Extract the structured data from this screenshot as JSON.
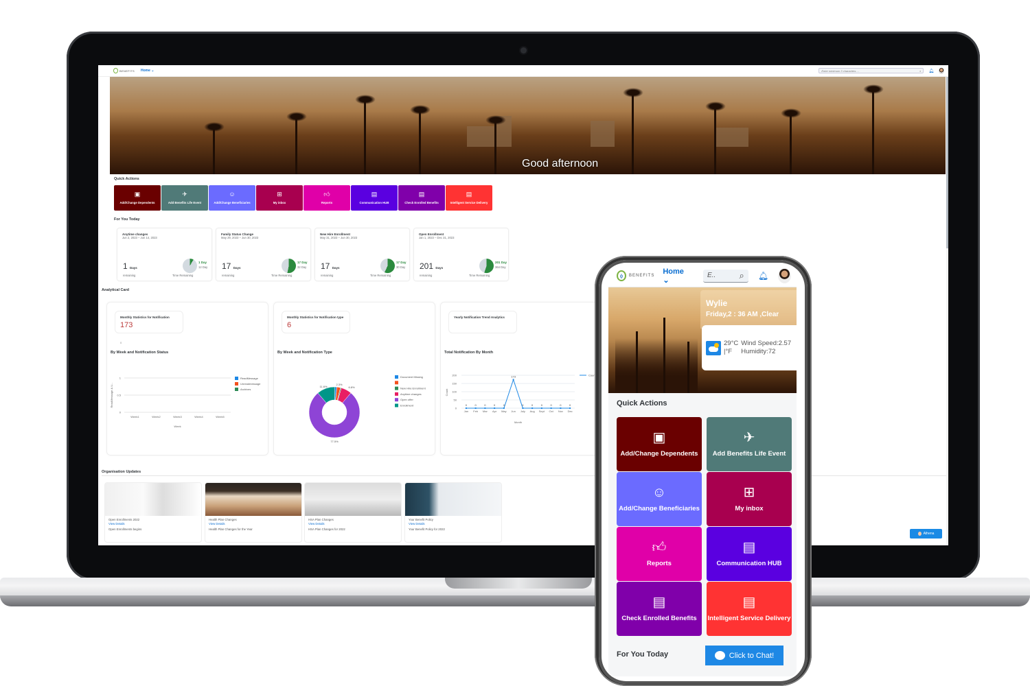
{
  "desktop": {
    "shell": {
      "logo_text": "BENEFITS",
      "home_label": "Home",
      "search_placeholder": "Enter minimum 3 characters ...",
      "icons": [
        "search-icon",
        "bell-icon",
        "user-avatar"
      ]
    },
    "hero": {
      "greeting": "Good afternoon"
    },
    "quick_actions": {
      "title": "Quick Actions",
      "items": [
        {
          "label": "Add/Change Dependents",
          "icon": "calendar-arrow-icon",
          "color": "#6a0000"
        },
        {
          "label": "Add Benefits Life Event",
          "icon": "airplane-icon",
          "color": "#507a78"
        },
        {
          "label": "Add/Change Beneficiaries",
          "icon": "chat-smile-icon",
          "color": "#6b6bff"
        },
        {
          "label": "My inbox",
          "icon": "clipboard-plus-icon",
          "color": "#a8004f"
        },
        {
          "label": "Reports",
          "icon": "thumbs-up-icon",
          "color": "#e000a8"
        },
        {
          "label": "Communication HUB",
          "icon": "id-card-icon",
          "color": "#5a00e0"
        },
        {
          "label": "Check Enrolled Benefits",
          "icon": "id-card-icon",
          "color": "#8000aa"
        },
        {
          "label": "Intelligent Service Delivery",
          "icon": "id-card-icon",
          "color": "#ff3333"
        }
      ]
    },
    "for_you_today": {
      "title": "For You Today",
      "cards": [
        {
          "title": "Anytime changes",
          "dates": "Jun 2, 2023 – Jun 14, 2023",
          "days": "1",
          "days_unit": "Days",
          "remaining_label": "remaining",
          "green": "1 Day",
          "total": "12 Day",
          "fraction": 0.083,
          "time_label": "Time Remaining"
        },
        {
          "title": "Family Status Change",
          "dates": "May 29, 2023 – Jun 30, 2023",
          "days": "17",
          "days_unit": "Days",
          "remaining_label": "remaining",
          "green": "17 Day",
          "total": "32 Day",
          "fraction": 0.53,
          "time_label": "Time Remaining"
        },
        {
          "title": "New Hire Enrollment",
          "dates": "May 31, 2023 – Jun 30, 2023",
          "days": "17",
          "days_unit": "Days",
          "remaining_label": "remaining",
          "green": "17 Day",
          "total": "30 Day",
          "fraction": 0.57,
          "time_label": "Time Remaining"
        },
        {
          "title": "Open Enrollment",
          "dates": "Jan 1, 2023 – Dec 31, 2023",
          "days": "201",
          "days_unit": "Days",
          "remaining_label": "remaining",
          "green": "201 Day",
          "total": "364 Day",
          "fraction": 0.55,
          "time_label": "Time Remaining"
        }
      ]
    },
    "analytical": {
      "title": "Analytical Card",
      "cards": [
        {
          "kpi_title": "Monthly Statistics for Notification",
          "kpi_value": "173",
          "kpi_sub": "0",
          "chart_title": "By Week and Notification Status"
        },
        {
          "kpi_title": "Monthly Statistics for Notification type",
          "kpi_value": "6",
          "chart_title": "By Week and Notification Type"
        },
        {
          "kpi_title": "Yearly Notification Trend Analytics",
          "chart_title": "Total Notification By Month"
        }
      ]
    },
    "org_updates": {
      "title": "Organisation Updates",
      "cards": [
        {
          "title": "Open Enrollments 2022",
          "link": "View Details",
          "desc": "Open Enrollments begins"
        },
        {
          "title": "Health Plan Changes",
          "link": "View Details",
          "desc": "Health Plan Changes for the Year"
        },
        {
          "title": "HSA Plan Changes",
          "link": "View Details",
          "desc": "HSA Plan Changes for 2022"
        },
        {
          "title": "Your Benefit Policy",
          "link": "View Details",
          "desc": "Your Benefit Policy for 2022"
        }
      ]
    },
    "assistant_button": "Athena"
  },
  "chart_data": [
    {
      "type": "line",
      "title": "By Week and Notification Status",
      "xlabel": "Week",
      "ylabel": "ReadMessage & U...",
      "categories": [
        "Week1",
        "Week2",
        "Week3",
        "Week4",
        "Week5"
      ],
      "yticks": [
        "0",
        "0.5",
        "1"
      ],
      "ylim": [
        0,
        1
      ],
      "legend": "right",
      "series": [
        {
          "name": "ReadMessage",
          "color": "#1e88e5",
          "values": []
        },
        {
          "name": "Unreadmessage",
          "color": "#f4511e",
          "values": []
        },
        {
          "name": "Archives",
          "color": "#2e8b57",
          "values": []
        }
      ]
    },
    {
      "type": "pie",
      "title": "By Week and Notification Type",
      "legend": "right",
      "slices": [
        {
          "name": "Document Missing",
          "value": 1.2,
          "color": "#1e88e5"
        },
        {
          "name": "",
          "value": 2.3,
          "color": "#f4511e"
        },
        {
          "name": "New Hire Enrollment",
          "value": 0.6,
          "color": "#2e8b57"
        },
        {
          "name": "Anytime changes",
          "value": 6.8,
          "color": "#e91e63"
        },
        {
          "name": "Open offer",
          "value": 77.5,
          "color": "#8e44d6"
        },
        {
          "name": "Enrollment",
          "value": 11.6,
          "color": "#009688"
        }
      ],
      "labels": [
        "11.6%",
        "2.3%",
        "6.8%",
        "77.5%"
      ]
    },
    {
      "type": "line",
      "title": "Total Notification By Month",
      "xlabel": "Month",
      "ylabel": "Count",
      "categories": [
        "Jan",
        "Feb",
        "Mar",
        "Apr",
        "May",
        "Jun",
        "July",
        "Aug",
        "Sept",
        "Oct",
        "Nov",
        "Dec"
      ],
      "yticks": [
        "0",
        "50",
        "100",
        "150",
        "200"
      ],
      "ylim": [
        0,
        200
      ],
      "legend": "right",
      "series": [
        {
          "name": "Count",
          "color": "#1e88e5",
          "values": [
            0,
            0,
            0,
            0,
            0,
            173,
            0,
            0,
            0,
            0,
            0,
            0
          ]
        }
      ]
    }
  ],
  "mobile": {
    "shell": {
      "logo_text": "BENEFITS",
      "home_label": "Home",
      "search_value": "E.."
    },
    "weather": {
      "city": "Wylie",
      "datetime": "Friday,2 : 36 AM ,Clear",
      "temp": "29°C",
      "unit_toggle": "|°F",
      "wind": "Wind Speed:2.57",
      "humidity": "Humidity:72"
    },
    "quick_actions_title": "Quick Actions",
    "for_you_today_title": "For You Today",
    "chat_button": "Click to Chat!"
  }
}
